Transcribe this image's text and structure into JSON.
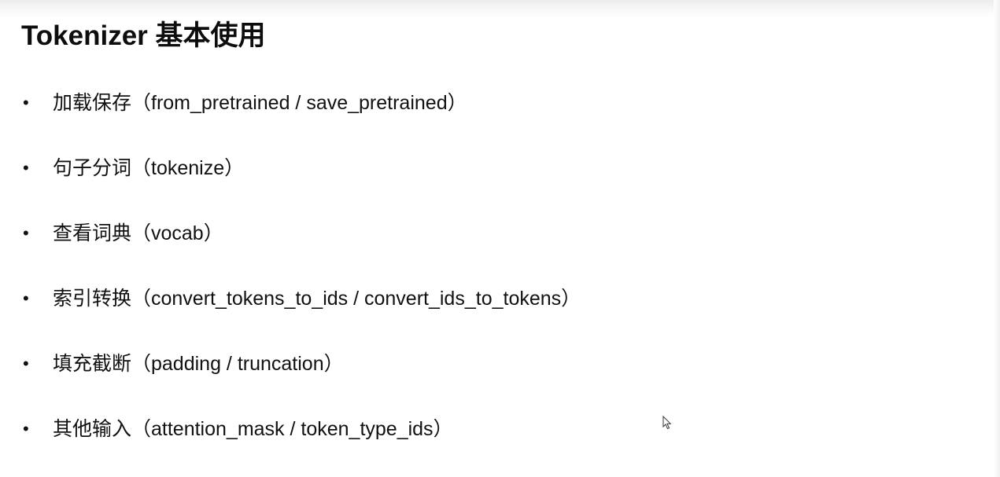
{
  "slide": {
    "title": "Tokenizer 基本使用",
    "bullet_symbol": "•",
    "bullets": [
      {
        "text": "加载保存（from_pretrained / save_pretrained）"
      },
      {
        "text": "句子分词（tokenize）"
      },
      {
        "text": "查看词典（vocab）"
      },
      {
        "text": "索引转换（convert_tokens_to_ids / convert_ids_to_tokens）"
      },
      {
        "text": "填充截断（padding / truncation）"
      },
      {
        "text": "其他输入（attention_mask / token_type_ids）"
      }
    ]
  },
  "icons": {
    "cursor": "mouse-pointer-icon"
  },
  "colors": {
    "text": "#111111",
    "background": "#ffffff"
  }
}
